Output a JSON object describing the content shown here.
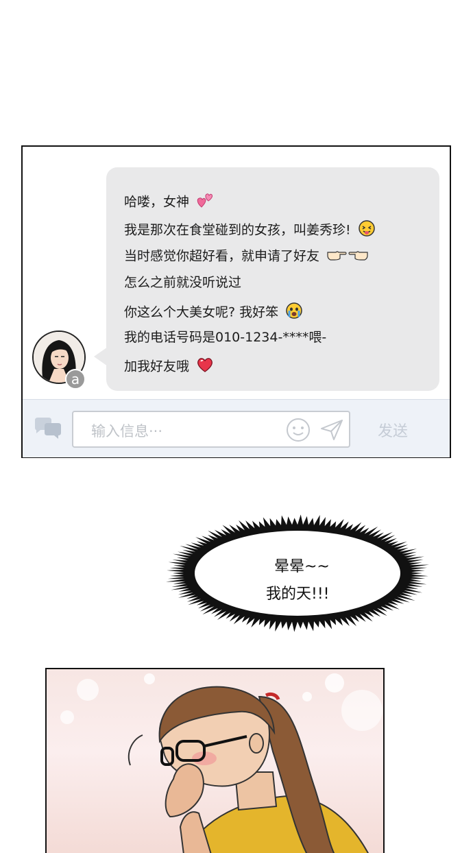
{
  "chat": {
    "messages": [
      {
        "text": "哈喽，女神",
        "emoji": "two-hearts"
      },
      {
        "text": "我是那次在食堂碰到的女孩，叫姜秀珍!",
        "emoji": "winking-tongue-face"
      },
      {
        "text": "当时感觉你超好看，就申请了好友",
        "emoji": "pointing-hands"
      },
      {
        "text": "怎么之前就没听说过",
        "emoji": ""
      },
      {
        "text": "你这么个大美女呢? 我好笨",
        "emoji": "crying-face"
      },
      {
        "text": "我的电话号码是010-1234-****喂-",
        "emoji": ""
      },
      {
        "text": "加我好友哦",
        "emoji": "red-heart"
      }
    ],
    "avatar_badge": "a",
    "input_placeholder": "输入信息···",
    "send_label": "发送"
  },
  "burst": {
    "line1": "晕晕~~",
    "line2": "我的天!!!"
  },
  "colors": {
    "bubble": "#e9e9ea",
    "input_bar": "#eef2f8",
    "heart": "#e8354a"
  }
}
